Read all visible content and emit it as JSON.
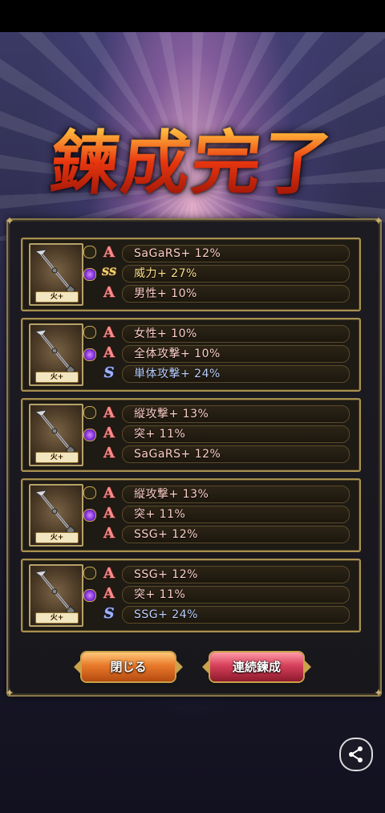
{
  "banner": {
    "title": "鍊成完了"
  },
  "cards": [
    {
      "element": "火+",
      "rows": [
        {
          "rank": "A",
          "label": "SaGaRS+ 12%"
        },
        {
          "rank": "SS",
          "label": "威力+ 27%"
        },
        {
          "rank": "A",
          "label": "男性+ 10%"
        }
      ]
    },
    {
      "element": "火+",
      "rows": [
        {
          "rank": "A",
          "label": "女性+ 10%"
        },
        {
          "rank": "A",
          "label": "全体攻撃+ 10%"
        },
        {
          "rank": "S",
          "label": "単体攻撃+ 24%"
        }
      ]
    },
    {
      "element": "火+",
      "rows": [
        {
          "rank": "A",
          "label": "縦攻撃+ 13%"
        },
        {
          "rank": "A",
          "label": "突+ 11%"
        },
        {
          "rank": "A",
          "label": "SaGaRS+ 12%"
        }
      ]
    },
    {
      "element": "火+",
      "rows": [
        {
          "rank": "A",
          "label": "縦攻撃+ 13%"
        },
        {
          "rank": "A",
          "label": "突+ 11%"
        },
        {
          "rank": "A",
          "label": "SSG+ 12%"
        }
      ]
    },
    {
      "element": "火+",
      "rows": [
        {
          "rank": "A",
          "label": "SSG+ 12%"
        },
        {
          "rank": "A",
          "label": "突+ 11%"
        },
        {
          "rank": "S",
          "label": "SSG+ 24%"
        }
      ]
    }
  ],
  "buttons": {
    "close": "閉じる",
    "continuous": "連続鍊成"
  },
  "icons": {
    "share": "share-icon",
    "weapon": "spear-icon"
  },
  "colors": {
    "rank_a": "#ff8a8a",
    "rank_s": "#9fb4ff",
    "rank_ss": "#ffd46a",
    "frame_gold": "#a8904e"
  }
}
